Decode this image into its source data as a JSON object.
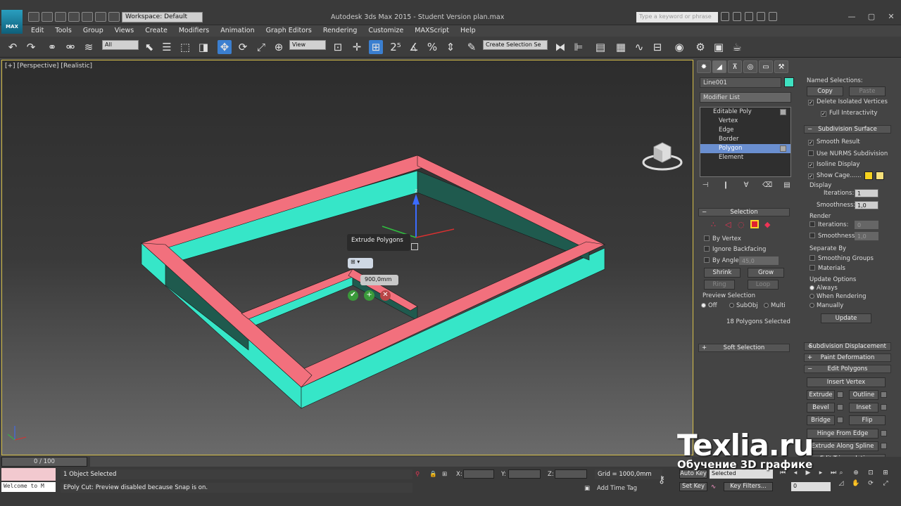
{
  "titlebar": {
    "logo": "MAX",
    "workspace": "Workspace: Default",
    "title": "Autodesk 3ds Max  2015  - Student Version    plan.max",
    "search_placeholder": "Type a keyword or phrase"
  },
  "menu": [
    "Edit",
    "Tools",
    "Group",
    "Views",
    "Create",
    "Modifiers",
    "Animation",
    "Graph Editors",
    "Rendering",
    "Customize",
    "MAXScript",
    "Help"
  ],
  "toolbar": {
    "filter": "All",
    "refcoord": "View",
    "named_sel": "Create Selection Se"
  },
  "viewport": {
    "label": "[+] [Perspective] [Realistic]",
    "caddy_tooltip": "Extrude Polygons",
    "caddy_value": "900,0mm"
  },
  "cmd": {
    "object_name": "Line001",
    "modifier_list": "Modifier List",
    "stack": [
      {
        "label": "Editable Poly",
        "level": "top",
        "selected": false
      },
      {
        "label": "Vertex",
        "level": "sub",
        "selected": false
      },
      {
        "label": "Edge",
        "level": "sub",
        "selected": false
      },
      {
        "label": "Border",
        "level": "sub",
        "selected": false
      },
      {
        "label": "Polygon",
        "level": "sub",
        "selected": true
      },
      {
        "label": "Element",
        "level": "sub",
        "selected": false
      }
    ],
    "selection": {
      "title": "Selection",
      "by_vertex": "By Vertex",
      "ignore_backfacing": "Ignore Backfacing",
      "by_angle": "By Angle:",
      "angle_value": "45,0",
      "shrink": "Shrink",
      "grow": "Grow",
      "ring": "Ring",
      "loop": "Loop",
      "preview_title": "Preview Selection",
      "preview_off": "Off",
      "preview_subobj": "SubObj",
      "preview_multi": "Multi",
      "status": "18 Polygons Selected"
    },
    "soft_selection": "Soft Selection",
    "right": {
      "named_selections": "Named Selections:",
      "copy": "Copy",
      "paste": "Paste",
      "delete_isolated": "Delete Isolated Vertices",
      "full_interactivity": "Full Interactivity",
      "subdiv_surface": "Subdivision Surface",
      "smooth_result": "Smooth Result",
      "use_nurms": "Use NURMS Subdivision",
      "isoline": "Isoline Display",
      "show_cage": "Show Cage......",
      "display": "Display",
      "iterations": "Iterations:",
      "iter_val": "1",
      "smoothness": "Smoothness:",
      "smooth_val": "1,0",
      "render": "Render",
      "r_iter_val": "0",
      "r_smooth_val": "1,0",
      "separate_by": "Separate By",
      "smoothing_groups": "Smoothing Groups",
      "materials": "Materials",
      "update_options": "Update Options",
      "always": "Always",
      "when_rendering": "When Rendering",
      "manually": "Manually",
      "update": "Update",
      "subdiv_disp": "Subdivision Displacement",
      "paint_deform": "Paint Deformation",
      "edit_polygons": "Edit Polygons",
      "insert_vertex": "Insert Vertex",
      "extrude": "Extrude",
      "outline": "Outline",
      "bevel": "Bevel",
      "inset": "Inset",
      "bridge": "Bridge",
      "flip": "Flip",
      "hinge": "Hinge From Edge",
      "extrude_spline": "Extrude Along Spline",
      "edit_tri": "Edit Triangulation"
    }
  },
  "status": {
    "time": "0 / 100",
    "selected": "1 Object Selected",
    "prompt": "EPoly Cut: Preview disabled because Snap is on.",
    "listener": "Welcome to M",
    "x": "X:",
    "y": "Y:",
    "z": "Z:",
    "grid": "Grid = 1000,0mm",
    "add_time_tag": "Add Time Tag",
    "auto_key": "Auto Key",
    "set_key": "Set Key",
    "selected_mode": "Selected",
    "key_filters": "Key Filters...",
    "frame": "0"
  },
  "watermark": {
    "brand": "Texlia.ru",
    "tagline": "Обучение 3D графике"
  },
  "colors": {
    "wall_top": "#f2707d",
    "wall_side": "#36e6c8",
    "wall_shadow": "#1f5a4e",
    "selection_blue": "#3b7fd0"
  }
}
